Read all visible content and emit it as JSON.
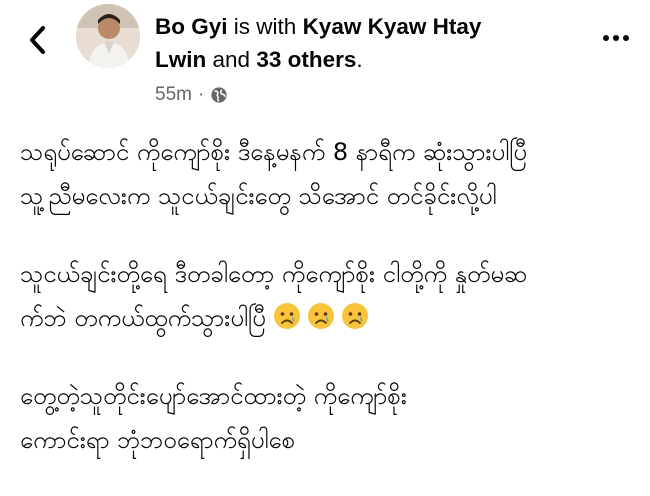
{
  "post_header": {
    "author": "Bo Gyi",
    "with_text": "is with",
    "tagged": "Kyaw Kyaw Htay",
    "tagged_cont": "Lwin",
    "and_text": "and",
    "others": "33 others",
    "period": ".",
    "time": "55m",
    "dot": "·",
    "icons": {
      "back": "chevron-left-icon",
      "audience": "globe-icon",
      "more": "more-dots-icon"
    }
  },
  "post": {
    "paragraphs": [
      [
        "သရုပ်ဆောင် ကိုကျော်စိုး ဒီနေ့မနက် 8 နာရီက ဆုံးသွားပါပြီ",
        "သူ့ညီမလေးက သူငယ်ချင်းတွေ သိအောင် တင်ခိုင်းလို့ပါ"
      ],
      [
        "သူငယ်ချင်းတို့ရေ ဒီတခါတော့ ကိုကျော်စိုး ငါတို့ကို နှုတ်မဆ",
        "က်ဘဲ တကယ်ထွက်သွားပါပြီ"
      ],
      [
        "တွေ့တဲ့သူတိုင်းပျော်အောင်ထားတဲ့  ကိုကျော်စိုး",
        "ကောင်းရာ ဘုံဘဝရောက်ရှိပါစေ"
      ]
    ],
    "emojis": [
      "crying-face-icon",
      "crying-face-icon",
      "crying-face-icon"
    ]
  }
}
